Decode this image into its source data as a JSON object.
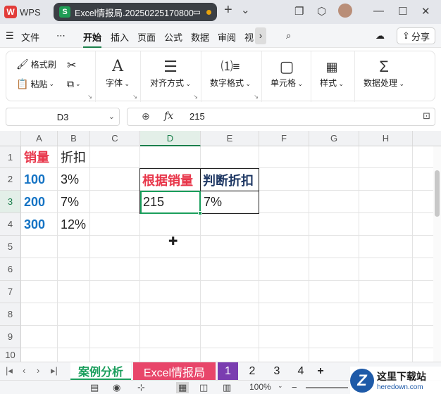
{
  "titlebar": {
    "app_tab_label": "WPS",
    "doc_tab_title": "Excel情报局.20250225170800",
    "new_tab": "+",
    "tab_menu": "⌄"
  },
  "menubar": {
    "file": "文件",
    "more": "⋯",
    "items": [
      "开始",
      "插入",
      "页面",
      "公式",
      "数据",
      "审阅",
      "视"
    ],
    "scroll_right": "›",
    "share": "分享"
  },
  "ribbon": {
    "format_painter": "格式刷",
    "paste": "粘贴",
    "font": "字体",
    "align": "对齐方式",
    "number_format": "数字格式",
    "cell": "单元格",
    "style": "样式",
    "data_process": "数据处理"
  },
  "formula": {
    "name_box": "D3",
    "fx": "fx",
    "value": "215"
  },
  "grid": {
    "columns": [
      "A",
      "B",
      "C",
      "D",
      "E",
      "F",
      "G",
      "H"
    ],
    "rows": [
      "1",
      "2",
      "3",
      "4",
      "5",
      "6",
      "7",
      "8",
      "9",
      "10"
    ],
    "selected_column": "D",
    "selected_row": "3",
    "cells": {
      "A1": "销量",
      "B1": "折扣",
      "A2": "100",
      "B2": "3%",
      "A3": "200",
      "B3": "7%",
      "A4": "300",
      "B4": "12%",
      "D2": "根据销量",
      "E2": "判断折扣",
      "D3": "215",
      "E3": "7%"
    },
    "colors": {
      "header_red": "#e8364a",
      "value_blue": "#1473c4",
      "header_navy": "#1f3864",
      "selection_green": "#1a9e5c"
    }
  },
  "sheets": {
    "tabs": [
      "案例分析",
      "Excel情报局",
      "1",
      "2",
      "3",
      "4"
    ],
    "add": "+",
    "active": "案例分析",
    "tab_colors": [
      "#ffffff",
      "#e8466a",
      "#7a3db0",
      "#f4f5f7",
      "#f4f5f7",
      "#f4f5f7"
    ]
  },
  "status": {
    "zoom": "100%"
  },
  "watermark": {
    "name": "这里下载站",
    "url": "heredown.com"
  }
}
